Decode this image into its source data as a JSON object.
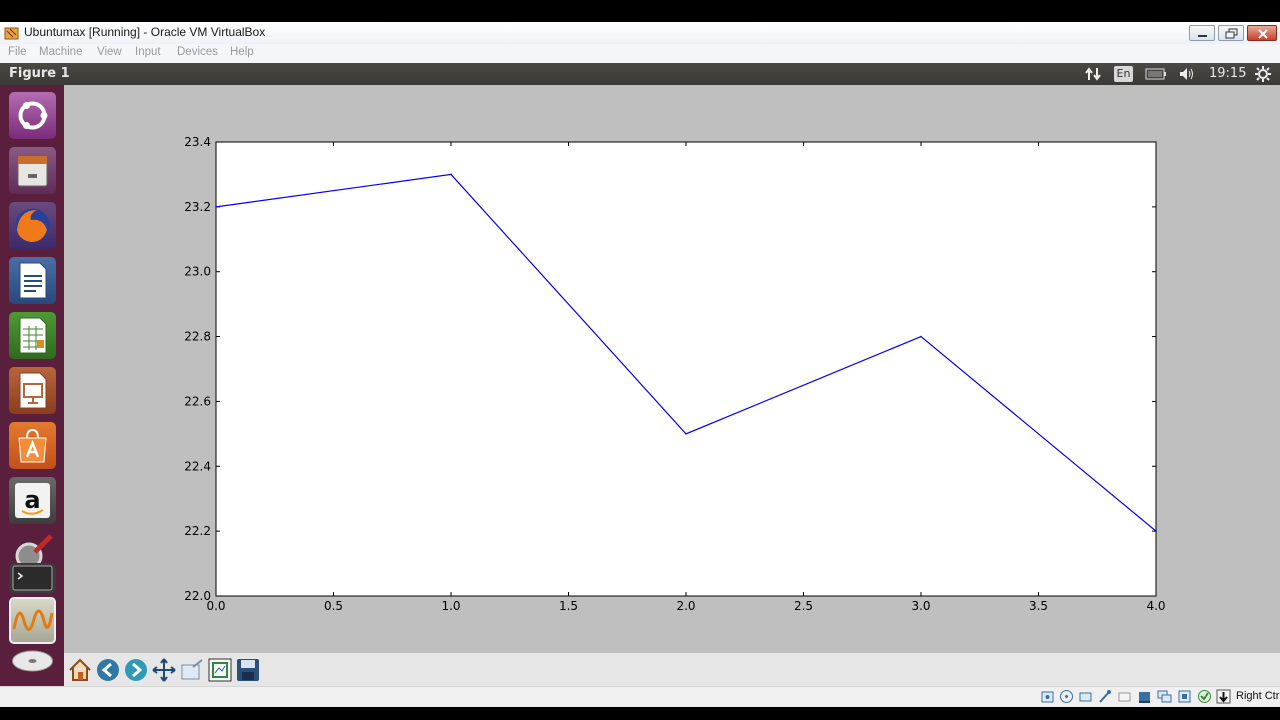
{
  "window": {
    "title": "Ubuntumax [Running] - Oracle VM VirtualBox"
  },
  "menubar": {
    "items": [
      "File",
      "Machine",
      "View",
      "Input",
      "Devices",
      "Help"
    ]
  },
  "panel": {
    "window_title": "Figure 1",
    "keyboard_layout": "En",
    "time": "19:15"
  },
  "launcher": {
    "icons": [
      "ubuntu-dash-icon",
      "files-icon",
      "firefox-icon",
      "libreoffice-writer-icon",
      "libreoffice-calc-icon",
      "libreoffice-impress-icon",
      "software-center-icon",
      "amazon-icon",
      "system-settings-icon",
      "terminal-icon",
      "figure-app-icon",
      "dvd-icon"
    ]
  },
  "toolbar": {
    "buttons": [
      "home-icon",
      "back-icon",
      "forward-icon",
      "pan-icon",
      "zoom-icon",
      "configure-subplots-icon",
      "save-icon"
    ]
  },
  "status_bar": {
    "host_key": "Right Ctrl"
  },
  "chart_data": {
    "type": "line",
    "x": [
      0,
      1,
      2,
      3,
      4
    ],
    "series": [
      {
        "values": [
          23.2,
          23.3,
          22.5,
          22.8,
          22.2
        ],
        "color": "#0000ff"
      }
    ],
    "xlim": [
      0.0,
      4.0
    ],
    "ylim": [
      22.0,
      23.4
    ],
    "xticks": [
      "0.0",
      "0.5",
      "1.0",
      "1.5",
      "2.0",
      "2.5",
      "3.0",
      "3.5",
      "4.0"
    ],
    "yticks": [
      "22.0",
      "22.2",
      "22.4",
      "22.6",
      "22.8",
      "23.0",
      "23.2",
      "23.4"
    ],
    "grid": false,
    "title": "",
    "xlabel": "",
    "ylabel": ""
  }
}
